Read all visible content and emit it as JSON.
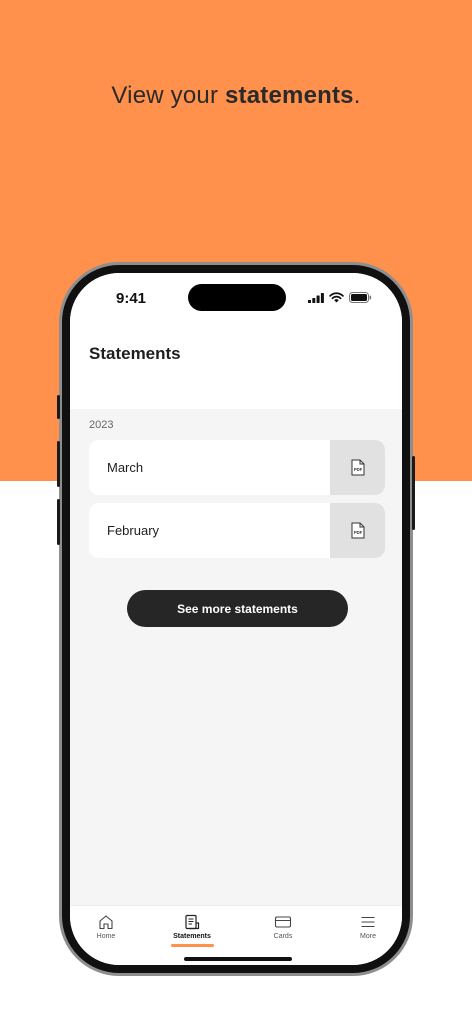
{
  "colors": {
    "accent": "#FF914D",
    "button": "#262626"
  },
  "headline": {
    "prefix": "View your ",
    "bold": "statements",
    "suffix": "."
  },
  "status_bar": {
    "time": "9:41",
    "icons": [
      "cellular-icon",
      "wifi-icon",
      "battery-icon"
    ]
  },
  "header": {
    "title": "Statements"
  },
  "statements": {
    "year": "2023",
    "items": [
      {
        "label": "March",
        "badge": "PDF"
      },
      {
        "label": "February",
        "badge": "PDF"
      }
    ]
  },
  "see_more": {
    "label": "See more statements"
  },
  "tabbar": {
    "tabs": [
      {
        "label": "Home",
        "icon": "home-icon"
      },
      {
        "label": "Statements",
        "icon": "statements-icon",
        "active": true
      },
      {
        "label": "Cards",
        "icon": "card-icon"
      },
      {
        "label": "More",
        "icon": "menu-icon"
      }
    ]
  }
}
